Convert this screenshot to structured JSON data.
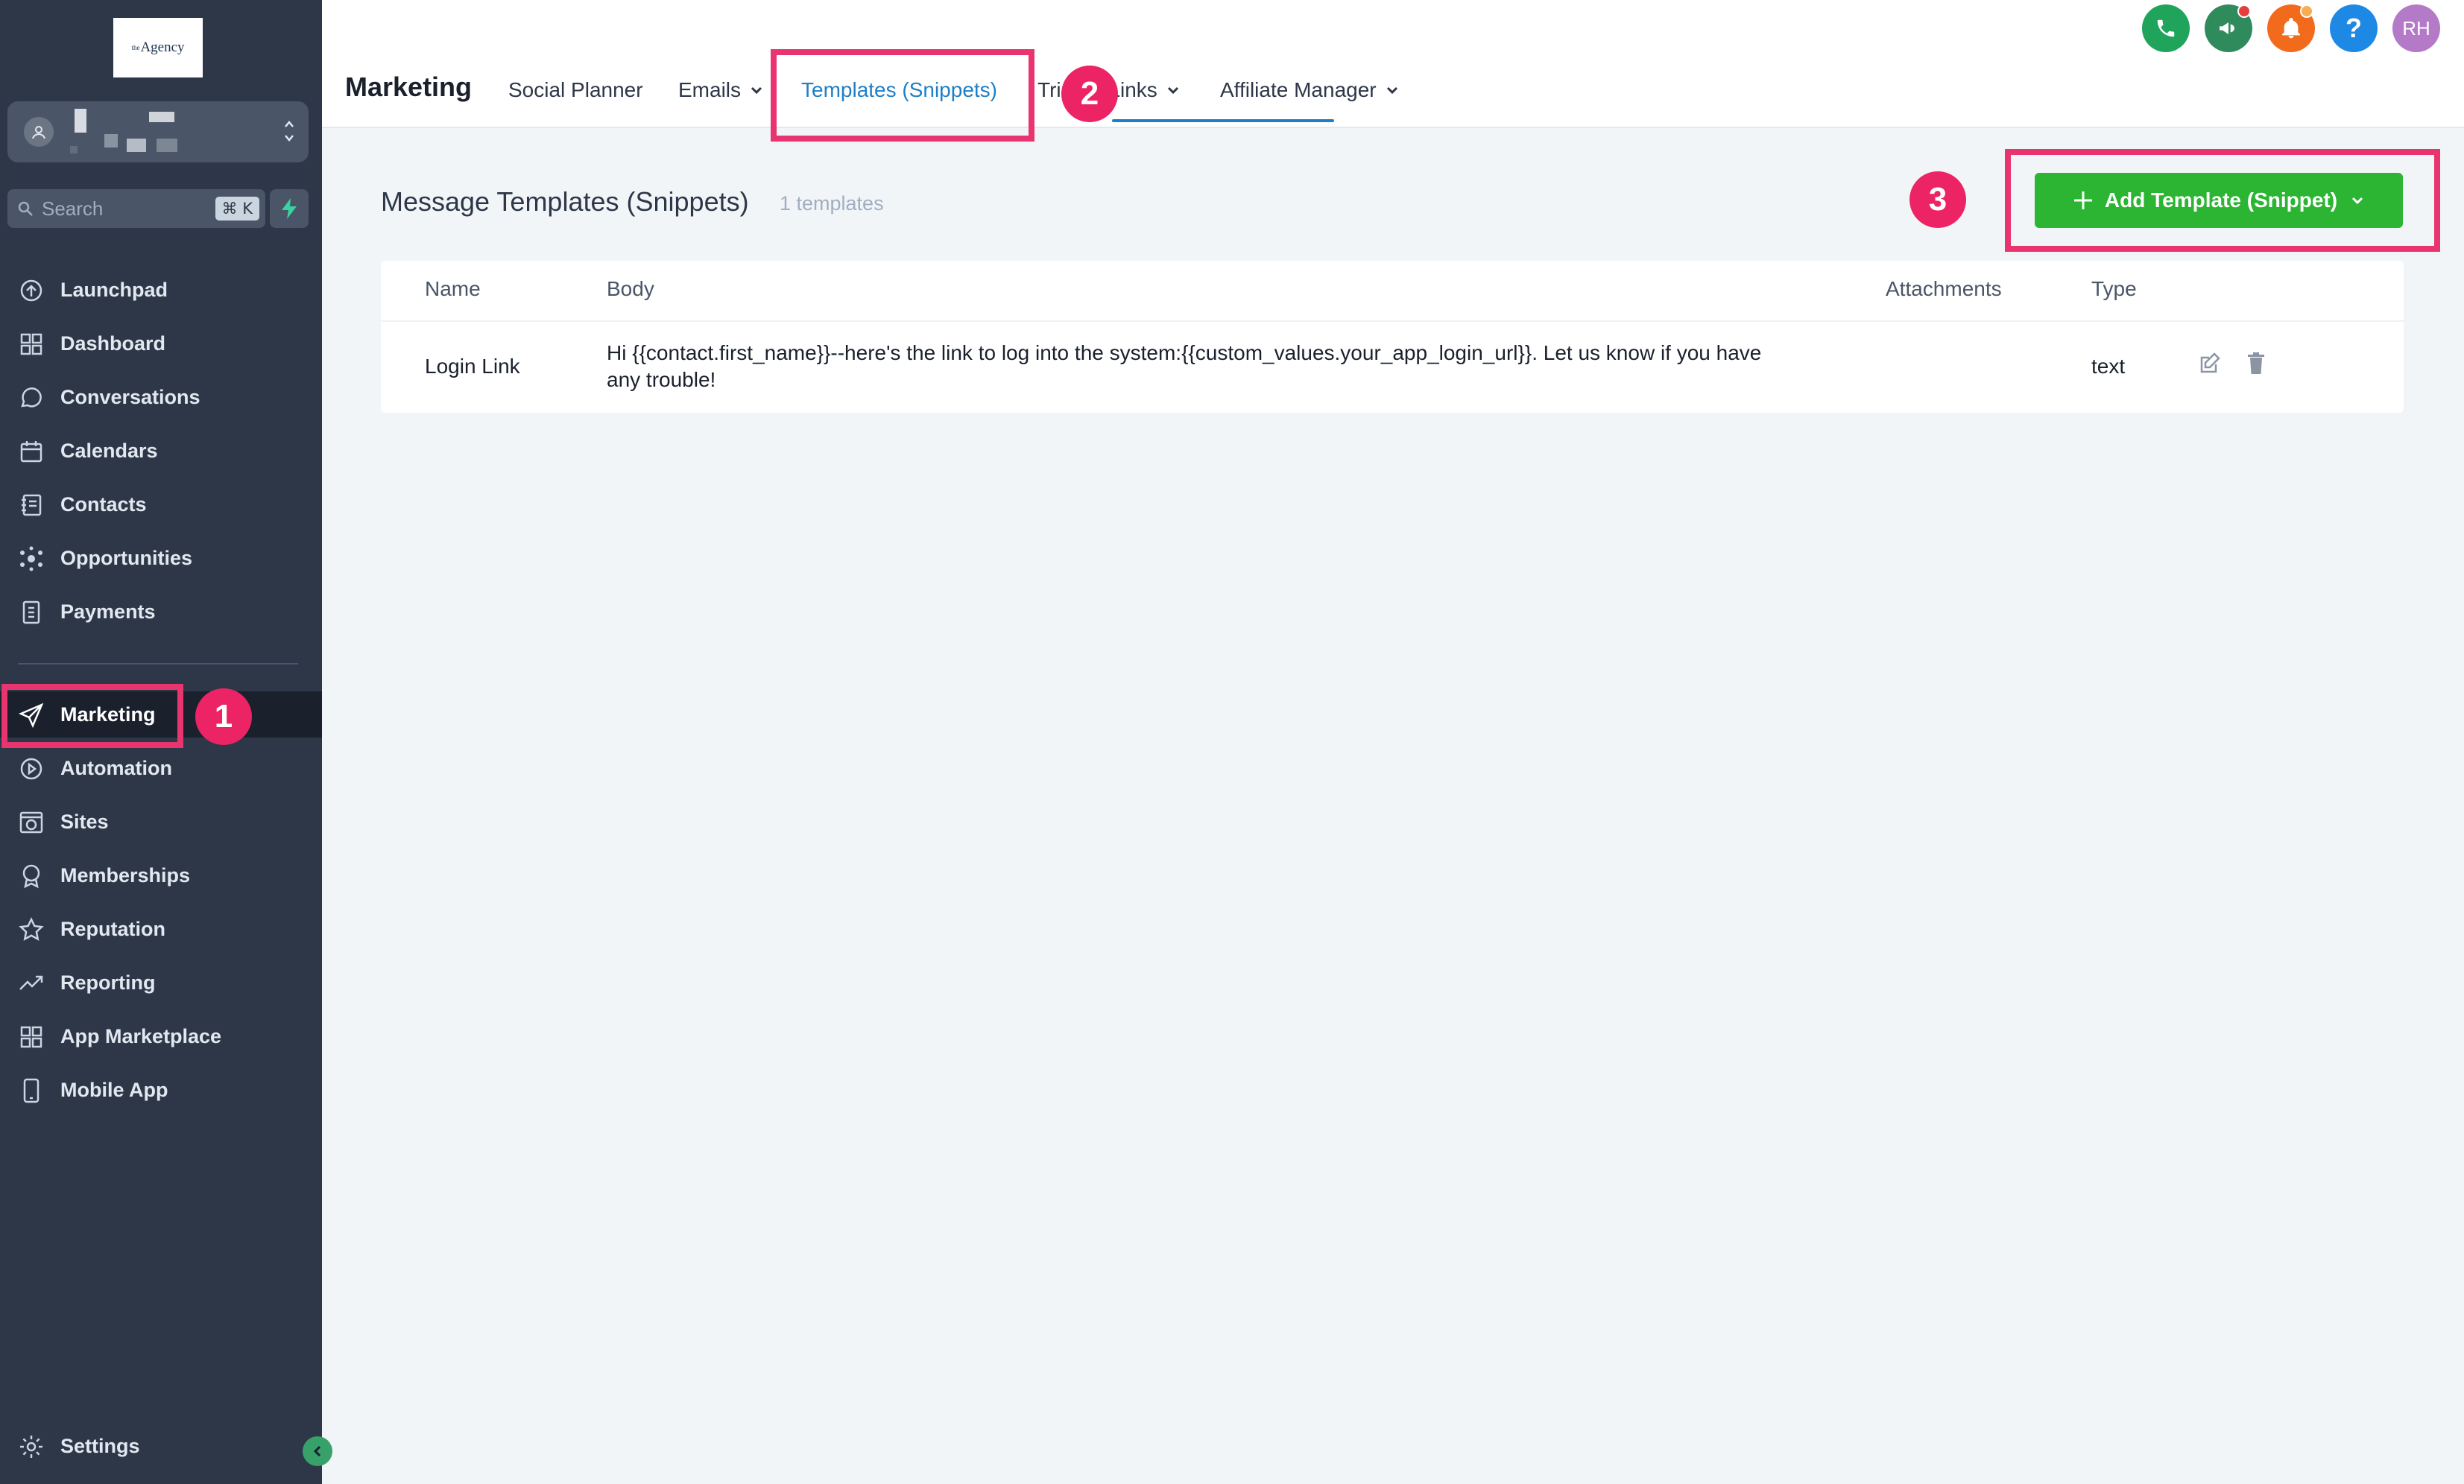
{
  "brand": {
    "logo_prefix": "the",
    "logo_text": "Agency"
  },
  "sidebar": {
    "search_label": "Search",
    "search_shortcut": "⌘ K",
    "items": [
      {
        "id": "launchpad",
        "label": "Launchpad",
        "icon": "launchpad-icon"
      },
      {
        "id": "dashboard",
        "label": "Dashboard",
        "icon": "grid-icon"
      },
      {
        "id": "conversations",
        "label": "Conversations",
        "icon": "chat-bubble-icon"
      },
      {
        "id": "calendars",
        "label": "Calendars",
        "icon": "calendar-icon"
      },
      {
        "id": "contacts",
        "label": "Contacts",
        "icon": "contacts-book-icon"
      },
      {
        "id": "opportunities",
        "label": "Opportunities",
        "icon": "network-icon"
      },
      {
        "id": "payments",
        "label": "Payments",
        "icon": "receipt-icon"
      },
      {
        "id": "marketing",
        "label": "Marketing",
        "icon": "paper-plane-icon",
        "active": true
      },
      {
        "id": "automation",
        "label": "Automation",
        "icon": "automation-icon"
      },
      {
        "id": "sites",
        "label": "Sites",
        "icon": "globe-window-icon"
      },
      {
        "id": "memberships",
        "label": "Memberships",
        "icon": "badge-icon"
      },
      {
        "id": "reputation",
        "label": "Reputation",
        "icon": "star-icon"
      },
      {
        "id": "reporting",
        "label": "Reporting",
        "icon": "trend-icon"
      },
      {
        "id": "app_marketplace",
        "label": "App Marketplace",
        "icon": "apps-icon"
      },
      {
        "id": "mobile_app",
        "label": "Mobile App",
        "icon": "phone-device-icon"
      }
    ],
    "settings_label": "Settings"
  },
  "header": {
    "title": "Marketing",
    "tabs": [
      {
        "label": "Social Planner"
      },
      {
        "label": "Emails",
        "dropdown": true
      },
      {
        "label": "Templates (Snippets)",
        "active": true
      },
      {
        "label": "Trigger Links",
        "dropdown": true
      },
      {
        "label": "Affiliate Manager",
        "dropdown": true
      }
    ],
    "user_initials": "RH",
    "colors": {
      "phone": "#20a35a",
      "megaphone": "#2f8a5c",
      "bell": "#f26b1d",
      "help": "#1e88e5",
      "avatar": "#b47ac8"
    }
  },
  "main": {
    "title": "Message Templates (Snippets)",
    "count": "1 templates",
    "add_button": "Add Template (Snippet)",
    "columns": [
      "Name",
      "Body",
      "Attachments",
      "Type"
    ],
    "rows": [
      {
        "name": "Login Link",
        "body_line1": "Hi {{contact.first_name}}--here's the link to log into the system:{{custom_values.your_app_login_url}}. Let us know if you have",
        "body_line2": "any trouble!",
        "attachments": "",
        "type": "text"
      }
    ]
  },
  "annotations": {
    "step1": "1",
    "step2": "2",
    "step3": "3"
  },
  "colors": {
    "accent_green": "#2bb532",
    "active_tab": "#1e7fc8",
    "highlight": "#e8346f",
    "sidebar_bg": "#2d3748"
  }
}
